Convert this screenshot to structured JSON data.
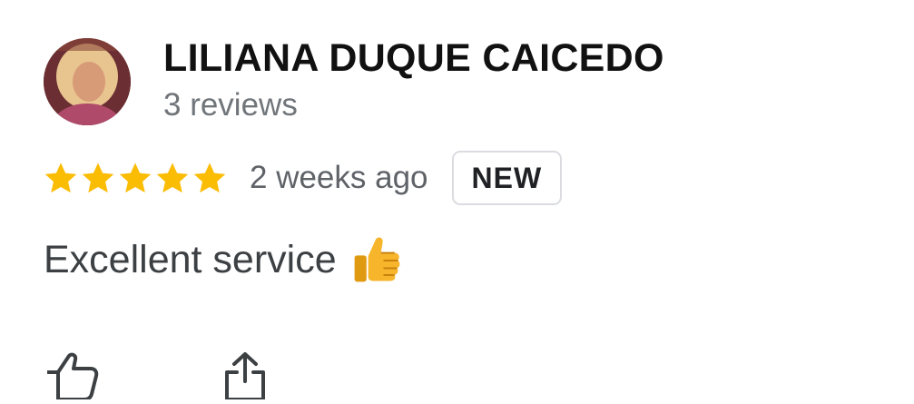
{
  "reviewer": {
    "name": "LILIANA DUQUE CAICEDO",
    "review_count": "3 reviews"
  },
  "review": {
    "rating": 5,
    "max_rating": 5,
    "time_ago": "2 weeks ago",
    "badge": "NEW",
    "text": "Excellent service",
    "emoji": "thumbs-up-emoji"
  },
  "actions": {
    "like_icon": "thumbs-up-outline-icon",
    "share_icon": "share-icon"
  },
  "colors": {
    "star": "#fbbc04",
    "name": "#111111",
    "secondary_text": "#70757a",
    "badge_border": "#dadce0"
  }
}
